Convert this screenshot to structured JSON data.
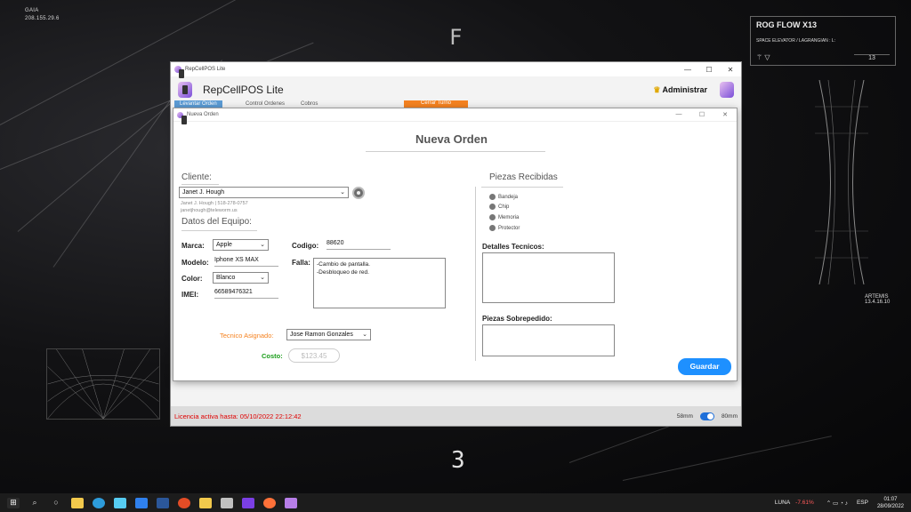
{
  "desktop": {
    "gaia_label": "GAIA",
    "gaia_ip": "208.155.29.6",
    "big_letter": "F",
    "big_number": "3",
    "rog_title": "ROG FLOW X13",
    "rog_subtitle": "SPACE ELEVATOR / LAGRANGIAN : L:",
    "rog_number": "13",
    "artemis_label": "ARTEMIS",
    "artemis_version": "13.4.16.10"
  },
  "main_window": {
    "window_title": "RepCellPOS Lite",
    "app_title": "RepCellPOS Lite",
    "user_label": "Administrar",
    "tabs": [
      "Levantar Orden",
      "Control Ordenes",
      "Cobros"
    ],
    "cerrar_turno": "Cerrar Turno",
    "license_text": "Licencia activa hasta: 05/10/2022 22:12:42",
    "paper_58": "58mm",
    "paper_80": "80mm"
  },
  "dialog": {
    "window_title": "Nueva Orden",
    "heading": "Nueva Orden",
    "cliente_label": "Cliente:",
    "cliente_value": "Janet J. Hough",
    "cliente_detail_1": "Janet J. Hough | 518-278-0757",
    "cliente_detail_2": "janetjhough@teleworm.us",
    "equipo_label": "Datos del Equipo:",
    "marca_label": "Marca:",
    "marca_value": "Apple",
    "modelo_label": "Modelo:",
    "modelo_value": "Iphone XS MAX",
    "color_label": "Color:",
    "color_value": "Blanco",
    "imei_label": "IMEI:",
    "imei_value": "66589476321",
    "codigo_label": "Codigo:",
    "codigo_value": "88620",
    "falla_label": "Falla:",
    "falla_line_1": "-Cambio de pantalla.",
    "falla_line_2": "-Desbloqueo de red.",
    "tecnico_label": "Tecnico Asignado:",
    "tecnico_value": "Jose Ramon Gonzales",
    "costo_label": "Costo:",
    "costo_placeholder": "$123.45",
    "piezas_label": "Piezas Recibidas",
    "piezas": [
      "Bandeja",
      "Chip",
      "Memoria",
      "Protector"
    ],
    "detalles_label": "Detalles Tecnicos:",
    "sobrepedido_label": "Piezas Sobrepedido:",
    "guardar": "Guardar",
    "colors": {
      "tecnico": "#f58220",
      "costo": "#1a9e1a",
      "guardar": "#1e90ff"
    }
  },
  "taskbar": {
    "luna": "LUNA",
    "luna_change": "-7.61%",
    "lang": "ESP",
    "time": "01:07",
    "date": "28/09/2022"
  }
}
